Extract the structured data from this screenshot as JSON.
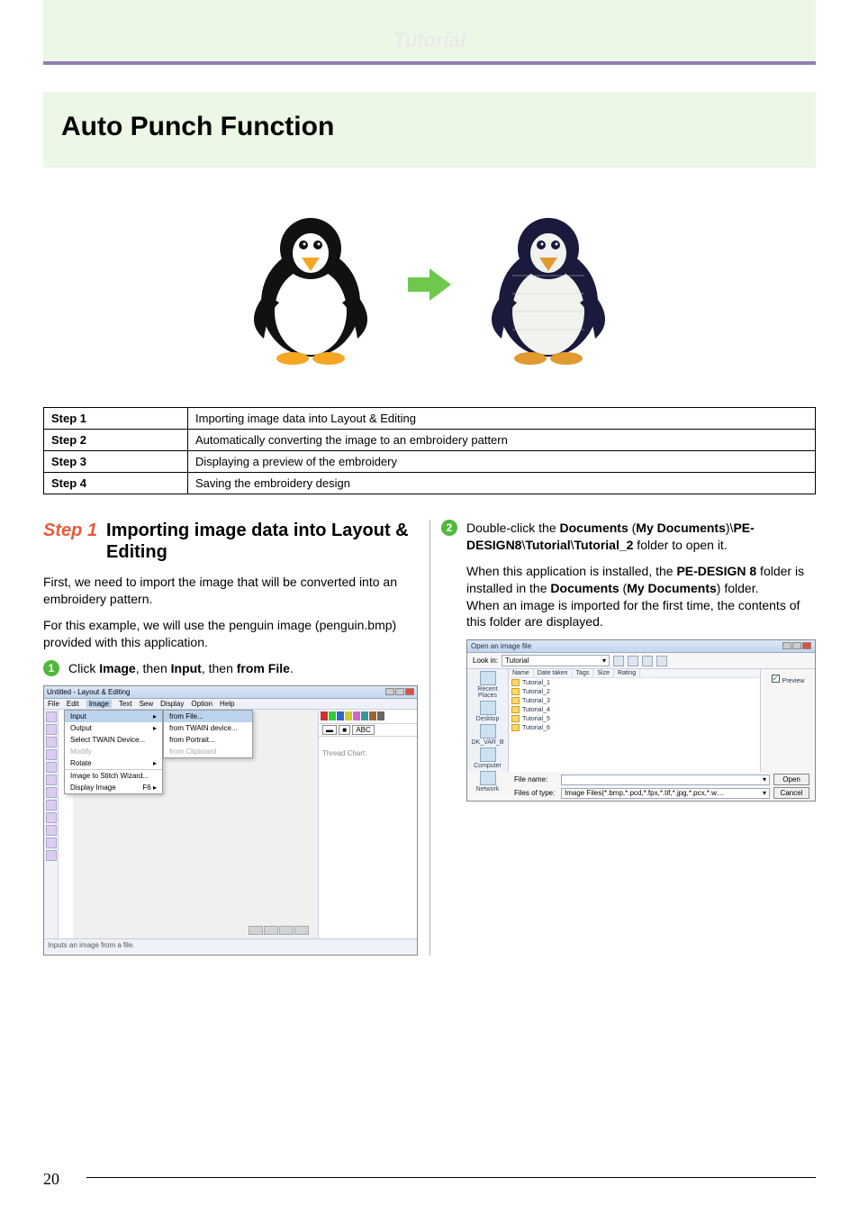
{
  "header": {
    "tutorial_label": "Tutorial"
  },
  "page": {
    "title": "Auto Punch Function",
    "number": "20"
  },
  "steps_table": {
    "rows": [
      {
        "label": "Step 1",
        "desc": "Importing image data into Layout & Editing"
      },
      {
        "label": "Step 2",
        "desc": "Automatically converting the image to an embroidery pattern"
      },
      {
        "label": "Step 3",
        "desc": "Displaying a preview of the embroidery"
      },
      {
        "label": "Step 4",
        "desc": "Saving the embroidery design"
      }
    ]
  },
  "left_column": {
    "step_num": "Step 1",
    "step_title": "Importing image data into Layout & Editing",
    "intro_line1": "First, we need to import the image that will be converted into an embroidery pattern.",
    "intro_line2": "For this example, we will use the penguin image (penguin.bmp) provided with this application.",
    "bullet1_num": "1",
    "bullet1_pre": "Click ",
    "bullet1_b1": "Image",
    "bullet1_mid1": ", then ",
    "bullet1_b2": "Input",
    "bullet1_mid2": ", then ",
    "bullet1_b3": "from File",
    "bullet1_end": "."
  },
  "right_column": {
    "bullet2_num": "2",
    "bullet2_pre": "Double-click the ",
    "bullet2_b1": "Documents",
    "bullet2_paren1_open": " (",
    "bullet2_b2": "My Documents",
    "bullet2_paren1_close": ")",
    "bullet2_sep0": "\\",
    "bullet2_b3": "PE-DESIGN8",
    "bullet2_sep1": "\\",
    "bullet2_b4": "Tutorial",
    "bullet2_sep2": "\\",
    "bullet2_b5": "Tutorial_2",
    "bullet2_tail": " folder to open it.",
    "para2_a": "When this application is installed, the ",
    "para2_b1": "PE-DESIGN 8",
    "para2_b": " folder is installed in the ",
    "para2_b2": "Documents",
    "para2_c": " (",
    "para2_b3": "My Documents",
    "para2_d": ") folder.",
    "para2_e": "When an image is imported for the first time, the contents of this folder are displayed."
  },
  "screenshot1": {
    "title": "Untitled - Layout & Editing",
    "menus": [
      "File",
      "Edit",
      "Image",
      "Text",
      "Sew",
      "Display",
      "Option",
      "Help"
    ],
    "dropdown": {
      "items": [
        "Input",
        "Output",
        "Select TWAIN Device...",
        "Modify",
        "Rotate",
        "Image to Stitch Wizard...",
        "Display Image"
      ],
      "shortcut": "F6 ▸"
    },
    "submenu": {
      "items": [
        "from File...",
        "from TWAIN device...",
        "from Portrait...",
        "from Clipboard"
      ]
    },
    "right_panel": {
      "abc": "ABC",
      "thread": "Thread Chart:"
    },
    "status": "Inputs an image from a file."
  },
  "screenshot2": {
    "title": "Open an image file",
    "lookin_label": "Look in:",
    "lookin_value": "Tutorial",
    "columns": [
      "Name",
      "Date taken",
      "Tags",
      "Size",
      "Rating"
    ],
    "places": [
      "Recent Places",
      "Desktop",
      "DK_VAR_B",
      "Computer",
      "Network"
    ],
    "folders": [
      "Tutorial_1",
      "Tutorial_2",
      "Tutorial_3",
      "Tutorial_4",
      "Tutorial_5",
      "Tutorial_6"
    ],
    "preview_label": "Preview",
    "filename_label": "File name:",
    "filetype_label": "Files of type:",
    "filetype_value": "Image Files(*.bmp,*.pcd,*.fpx,*.tif,*.jpg,*.pcx,*.w…",
    "open_btn": "Open",
    "cancel_btn": "Cancel"
  }
}
